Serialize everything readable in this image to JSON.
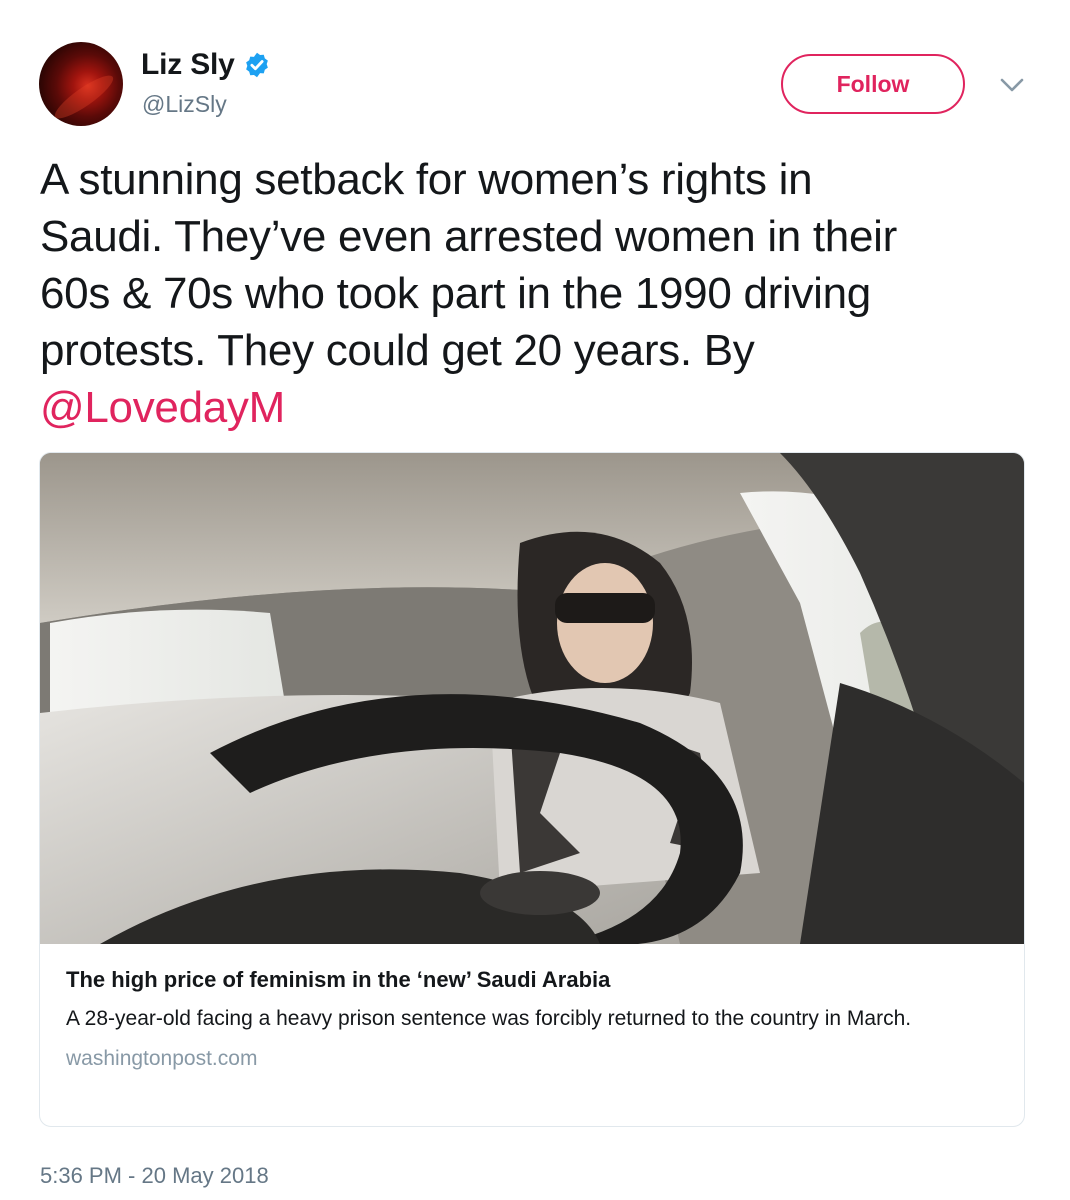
{
  "author": {
    "name": "Liz Sly",
    "handle": "@LizSly",
    "verified": true
  },
  "actions": {
    "follow_label": "Follow"
  },
  "tweet": {
    "lines": [
      "A stunning setback for women’s rights in",
      "Saudi. They’ve even arrested women in their",
      "60s & 70s who took part in the 1990 driving",
      "protests. They could get 20 years. By"
    ],
    "mention": "@LovedayM"
  },
  "card": {
    "title": "The high price of feminism in the ‘new’ Saudi Arabia",
    "description": "A 28-year-old facing a heavy prison sentence was forcibly returned to the country in March.",
    "domain": "washingtonpost.com"
  },
  "timestamp": "5:36 PM - 20 May 2018",
  "icons": {
    "verified": "verified-badge-icon",
    "menu": "chevron-down-icon"
  },
  "colors": {
    "accent": "#e0245e",
    "verified": "#1da1f2",
    "secondary_text": "#657786",
    "card_border": "#e1e8ed"
  }
}
